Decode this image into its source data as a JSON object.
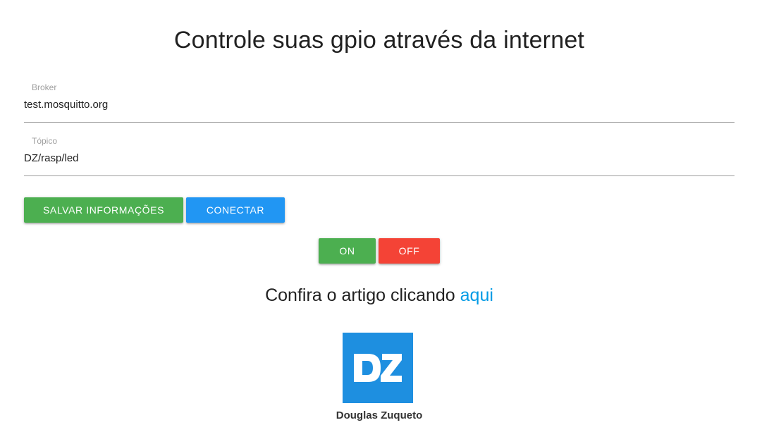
{
  "header": {
    "title": "Controle suas gpio através da internet"
  },
  "form": {
    "broker": {
      "label": "Broker",
      "value": "test.mosquitto.org"
    },
    "topic": {
      "label": "Tópico",
      "value": "DZ/rasp/led"
    }
  },
  "actions": {
    "save_label": "Salvar informações",
    "connect_label": "Conectar"
  },
  "gpio": {
    "on_label": "ON",
    "off_label": "OFF"
  },
  "article": {
    "text": "Confira o artigo clicando",
    "link_label": "aqui"
  },
  "author": {
    "logo_text": "DZ",
    "name": "Douglas Zuqueto"
  },
  "colors": {
    "green": "#4caf50",
    "blue": "#2196f3",
    "red": "#f44336",
    "link": "#039be5",
    "logo_bg": "#1e8fe0"
  }
}
